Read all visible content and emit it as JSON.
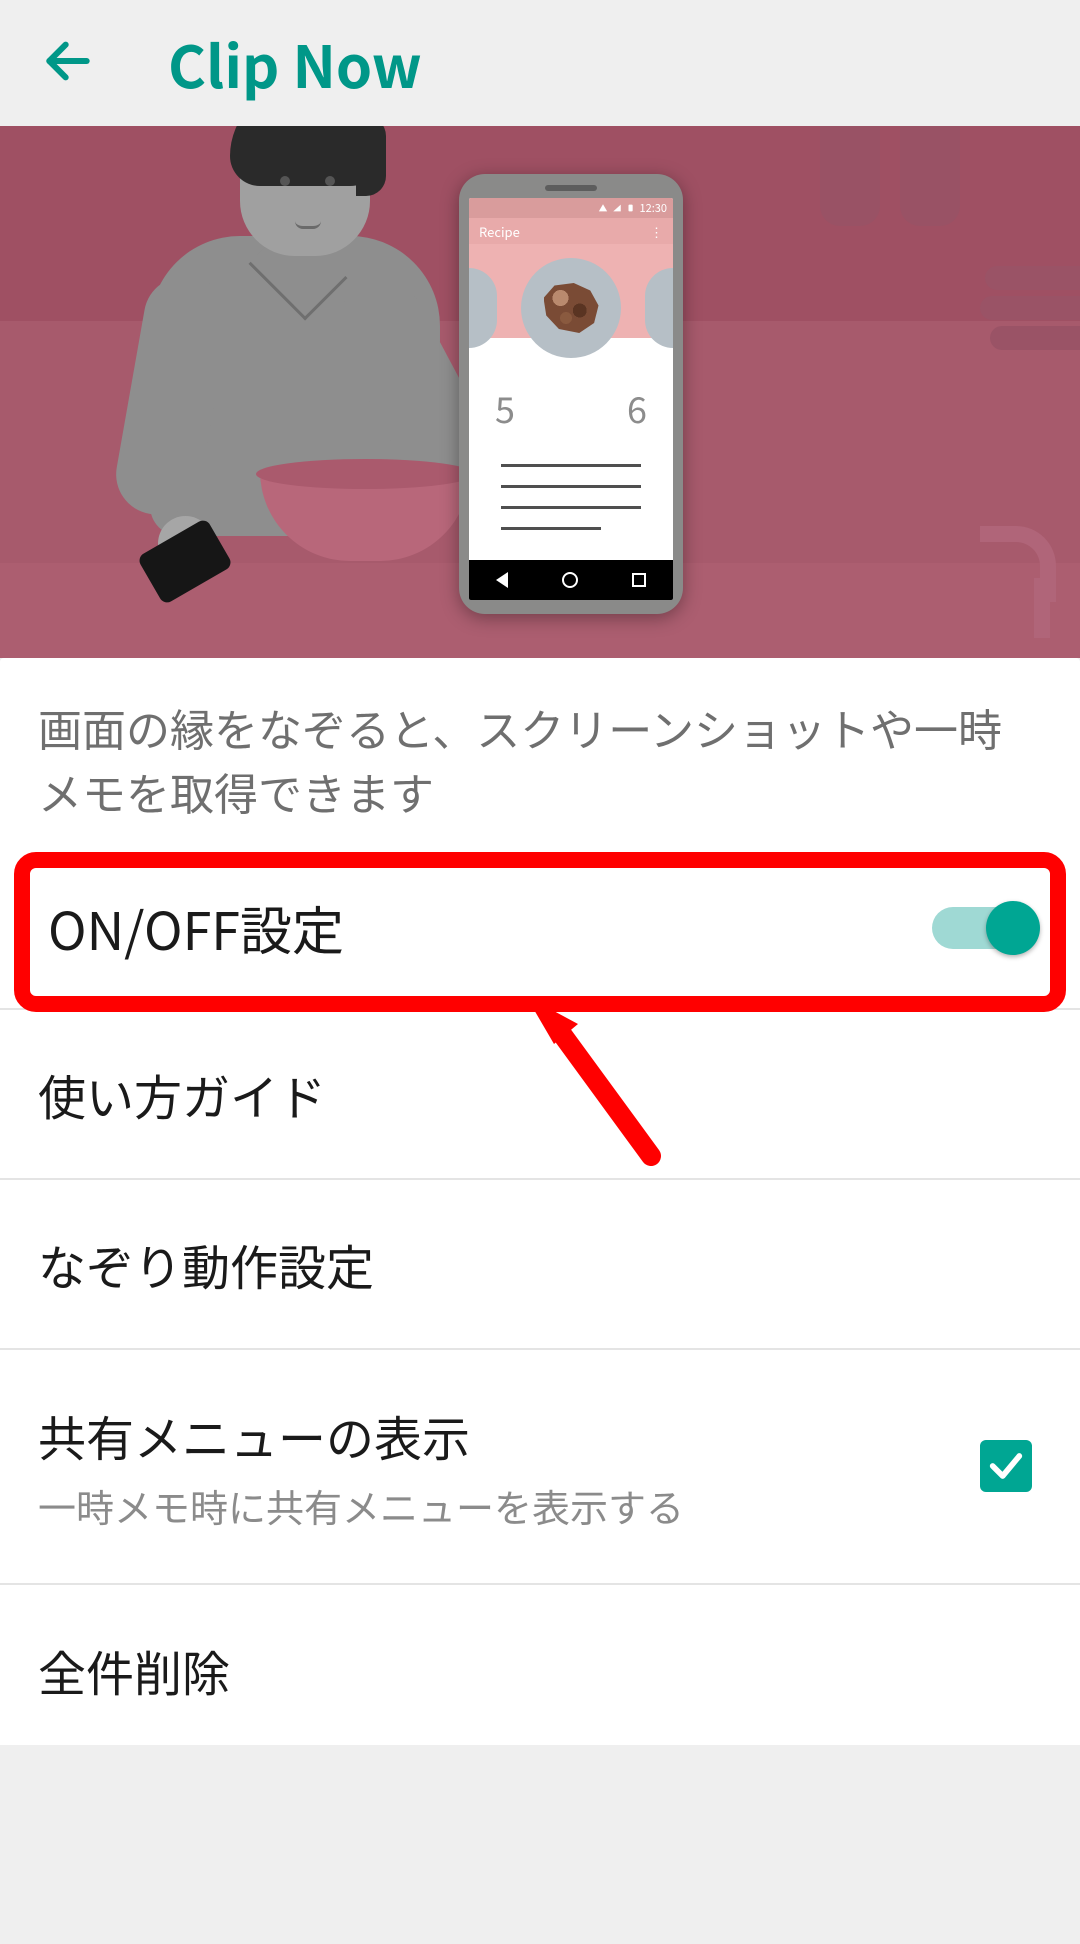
{
  "header": {
    "title": "Clip Now"
  },
  "illustration": {
    "phone": {
      "status_time": "12:30",
      "app_label": "Recipe",
      "num_left": "5",
      "num_right": "6"
    }
  },
  "description": "画面の縁をなぞると、スクリーンショットや一時メモを取得できます",
  "settings": {
    "onoff": {
      "label": "ON/OFF設定",
      "state": true
    },
    "guide": {
      "label": "使い方ガイド"
    },
    "swipe": {
      "label": "なぞり動作設定"
    },
    "share": {
      "label": "共有メニューの表示",
      "sublabel": "一時メモ時に共有メニューを表示する",
      "checked": true
    },
    "cutoff": {
      "label_partial": "全件削除"
    }
  },
  "annotation": {
    "highlight_target": "onoff-setting-row"
  },
  "colors": {
    "accent": "#009788",
    "highlight": "#ff0000"
  }
}
